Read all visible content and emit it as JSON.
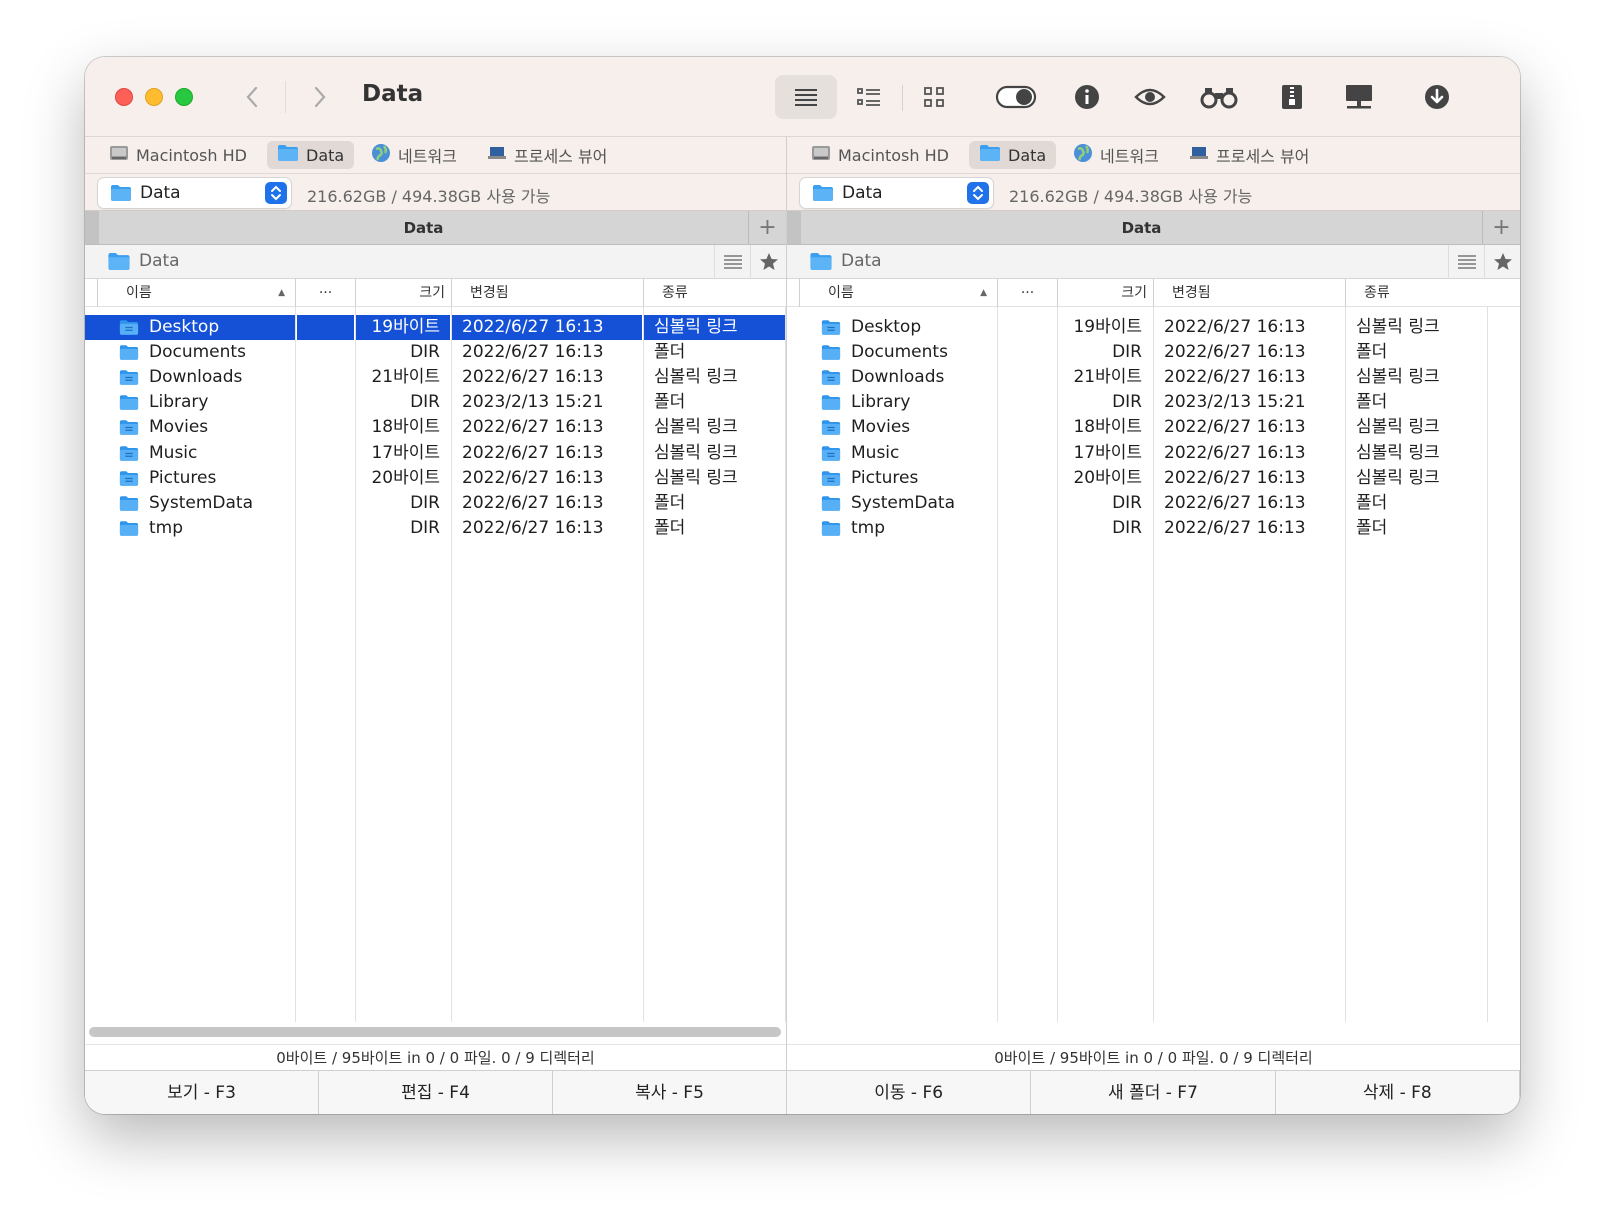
{
  "window": {
    "title": "Data"
  },
  "toolbar": {
    "icons": [
      "list-view-icon",
      "detail-view-icon",
      "icon-view-icon",
      "hidden-files-toggle-icon",
      "info-icon",
      "quick-look-eye-icon",
      "search-binoculars-icon",
      "archive-zip-icon",
      "network-connect-icon",
      "download-icon"
    ]
  },
  "drive_tabs": [
    {
      "label": "Macintosh HD",
      "icon": "hard-drive-icon"
    },
    {
      "label": "Data",
      "icon": "folder-icon",
      "active": true
    },
    {
      "label": "네트워크",
      "icon": "globe-icon"
    },
    {
      "label": "프로세스 뷰어",
      "icon": "laptop-icon"
    }
  ],
  "panels": [
    {
      "volume": "Data",
      "space": "216.62GB / 494.38GB 사용 가능",
      "tab_title": "Data",
      "folder": "Data",
      "columns": {
        "name": "이름",
        "ext": "···",
        "size": "크기",
        "modified": "변경됨",
        "kind": "종류"
      },
      "selected_index": 0,
      "status": "0바이트 / 95바이트 in 0 / 0 파일. 0 / 9 디렉터리"
    },
    {
      "volume": "Data",
      "space": "216.62GB / 494.38GB 사용 가능",
      "tab_title": "Data",
      "folder": "Data",
      "columns": {
        "name": "이름",
        "ext": "···",
        "size": "크기",
        "modified": "변경됨",
        "kind": "종류"
      },
      "selected_index": -1,
      "status": "0바이트 / 95바이트 in 0 / 0 파일. 0 / 9 디렉터리"
    }
  ],
  "files": [
    {
      "name": "Desktop",
      "size": "19바이트",
      "modified": "2022/6/27 16:13",
      "kind": "심볼릭 링크",
      "icon": "desktop-folder-icon"
    },
    {
      "name": "Documents",
      "size": "DIR",
      "modified": "2022/6/27 16:13",
      "kind": "폴더",
      "icon": "folder-icon"
    },
    {
      "name": "Downloads",
      "size": "21바이트",
      "modified": "2022/6/27 16:13",
      "kind": "심볼릭 링크",
      "icon": "downloads-folder-icon"
    },
    {
      "name": "Library",
      "size": "DIR",
      "modified": "2023/2/13 15:21",
      "kind": "폴더",
      "icon": "folder-icon"
    },
    {
      "name": "Movies",
      "size": "18바이트",
      "modified": "2022/6/27 16:13",
      "kind": "심볼릭 링크",
      "icon": "movies-folder-icon"
    },
    {
      "name": "Music",
      "size": "17바이트",
      "modified": "2022/6/27 16:13",
      "kind": "심볼릭 링크",
      "icon": "music-folder-icon"
    },
    {
      "name": "Pictures",
      "size": "20바이트",
      "modified": "2022/6/27 16:13",
      "kind": "심볼릭 링크",
      "icon": "pictures-folder-icon"
    },
    {
      "name": "SystemData",
      "size": "DIR",
      "modified": "2022/6/27 16:13",
      "kind": "폴더",
      "icon": "folder-icon"
    },
    {
      "name": "tmp",
      "size": "DIR",
      "modified": "2022/6/27 16:13",
      "kind": "폴더",
      "icon": "folder-icon"
    }
  ],
  "function_keys": [
    "보기 - F3",
    "편집 - F4",
    "복사 - F5",
    "이동 - F6",
    "새 폴더 - F7",
    "삭제 - F8"
  ],
  "colors": {
    "selection": "#1551d6",
    "folder": "#3a9ff0",
    "accent": "#1f72ea",
    "titlebar": "#f6efec"
  }
}
